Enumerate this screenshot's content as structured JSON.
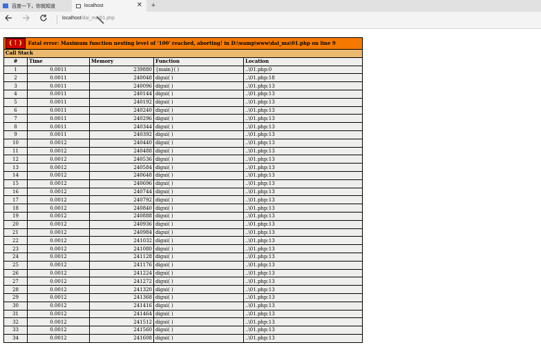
{
  "browser": {
    "tabs": [
      {
        "title": "百度一下，你就知道",
        "active": false
      },
      {
        "title": "localhost",
        "active": true
      }
    ],
    "new_tab_label": "+",
    "close_label": "✕",
    "url_host": "localhost",
    "url_path": "/dai_ma/01.php"
  },
  "error": {
    "badge": "( ! )",
    "message": "Fatal error: Maximum function nesting level of '100' reached, aborting! in D:\\wamp\\www\\dai_ma\\01.php on line 9",
    "call_stack_title": "Call Stack",
    "headers": [
      "#",
      "Time",
      "Memory",
      "Function",
      "Location"
    ],
    "rows": [
      [
        "1",
        "0.0011",
        "239880",
        "{main}( )",
        "..\\01.php:0"
      ],
      [
        "2",
        "0.0011",
        "240048",
        "digui( )",
        "..\\01.php:18"
      ],
      [
        "3",
        "0.0011",
        "240096",
        "digui( )",
        "..\\01.php:13"
      ],
      [
        "4",
        "0.0011",
        "240144",
        "digui( )",
        "..\\01.php:13"
      ],
      [
        "5",
        "0.0011",
        "240192",
        "digui( )",
        "..\\01.php:13"
      ],
      [
        "6",
        "0.0011",
        "240240",
        "digui( )",
        "..\\01.php:13"
      ],
      [
        "7",
        "0.0011",
        "240296",
        "digui( )",
        "..\\01.php:13"
      ],
      [
        "8",
        "0.0011",
        "240344",
        "digui( )",
        "..\\01.php:13"
      ],
      [
        "9",
        "0.0011",
        "240392",
        "digui( )",
        "..\\01.php:13"
      ],
      [
        "10",
        "0.0012",
        "240440",
        "digui( )",
        "..\\01.php:13"
      ],
      [
        "11",
        "0.0012",
        "240488",
        "digui( )",
        "..\\01.php:13"
      ],
      [
        "12",
        "0.0012",
        "240536",
        "digui( )",
        "..\\01.php:13"
      ],
      [
        "13",
        "0.0012",
        "240584",
        "digui( )",
        "..\\01.php:13"
      ],
      [
        "14",
        "0.0012",
        "240648",
        "digui( )",
        "..\\01.php:13"
      ],
      [
        "15",
        "0.0012",
        "240696",
        "digui( )",
        "..\\01.php:13"
      ],
      [
        "16",
        "0.0012",
        "240744",
        "digui( )",
        "..\\01.php:13"
      ],
      [
        "17",
        "0.0012",
        "240792",
        "digui( )",
        "..\\01.php:13"
      ],
      [
        "18",
        "0.0012",
        "240840",
        "digui( )",
        "..\\01.php:13"
      ],
      [
        "19",
        "0.0012",
        "240888",
        "digui( )",
        "..\\01.php:13"
      ],
      [
        "20",
        "0.0012",
        "240936",
        "digui( )",
        "..\\01.php:13"
      ],
      [
        "21",
        "0.0012",
        "240984",
        "digui( )",
        "..\\01.php:13"
      ],
      [
        "22",
        "0.0012",
        "241032",
        "digui( )",
        "..\\01.php:13"
      ],
      [
        "23",
        "0.0012",
        "241080",
        "digui( )",
        "..\\01.php:13"
      ],
      [
        "24",
        "0.0012",
        "241128",
        "digui( )",
        "..\\01.php:13"
      ],
      [
        "25",
        "0.0012",
        "241176",
        "digui( )",
        "..\\01.php:13"
      ],
      [
        "26",
        "0.0012",
        "241224",
        "digui( )",
        "..\\01.php:13"
      ],
      [
        "27",
        "0.0012",
        "241272",
        "digui( )",
        "..\\01.php:13"
      ],
      [
        "28",
        "0.0012",
        "241320",
        "digui( )",
        "..\\01.php:13"
      ],
      [
        "29",
        "0.0012",
        "241368",
        "digui( )",
        "..\\01.php:13"
      ],
      [
        "30",
        "0.0012",
        "241416",
        "digui( )",
        "..\\01.php:13"
      ],
      [
        "31",
        "0.0012",
        "241464",
        "digui( )",
        "..\\01.php:13"
      ],
      [
        "32",
        "0.0012",
        "241512",
        "digui( )",
        "..\\01.php:13"
      ],
      [
        "33",
        "0.0012",
        "241560",
        "digui( )",
        "..\\01.php:13"
      ],
      [
        "34",
        "0.0012",
        "241608",
        "digui( )",
        "..\\01.php:13"
      ]
    ]
  },
  "colors": {
    "error_header": "#f57900",
    "badge_bg": "#cc0000",
    "badge_fg": "#fce94f",
    "call_stack_header": "#e9b96e",
    "cell_bg": "#eeeeec"
  }
}
